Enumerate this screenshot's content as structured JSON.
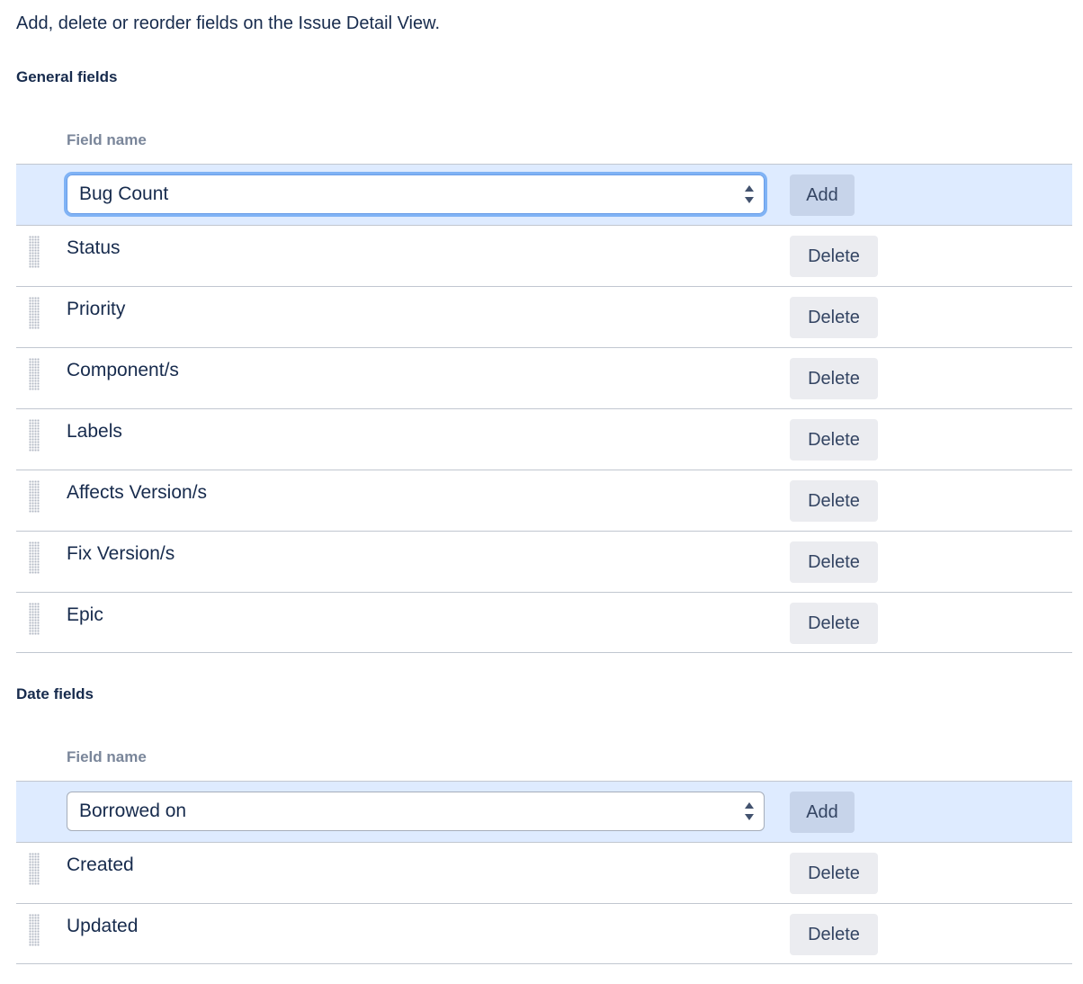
{
  "intro_text": "Add, delete or reorder fields on the Issue Detail View.",
  "sections": {
    "general": {
      "title": "General fields",
      "column_header": "Field name",
      "select_value": "Bug Count",
      "add_label": "Add",
      "fields": [
        {
          "label": "Status",
          "action": "Delete"
        },
        {
          "label": "Priority",
          "action": "Delete"
        },
        {
          "label": "Component/s",
          "action": "Delete"
        },
        {
          "label": "Labels",
          "action": "Delete"
        },
        {
          "label": "Affects Version/s",
          "action": "Delete"
        },
        {
          "label": "Fix Version/s",
          "action": "Delete"
        },
        {
          "label": "Epic",
          "action": "Delete"
        }
      ]
    },
    "date": {
      "title": "Date fields",
      "column_header": "Field name",
      "select_value": "Borrowed on",
      "add_label": "Add",
      "fields": [
        {
          "label": "Created",
          "action": "Delete"
        },
        {
          "label": "Updated",
          "action": "Delete"
        }
      ]
    }
  },
  "icons": {
    "select_arrows": "up-down-arrows-icon",
    "drag_handle": "drag-handle-icon"
  },
  "colors": {
    "text": "#172b4d",
    "muted_header": "#7a869a",
    "add_row_bg": "#deebff",
    "add_button_bg": "#c7d4ea",
    "delete_button_bg": "#ebecf0",
    "focus_ring": "#80b3f5"
  }
}
